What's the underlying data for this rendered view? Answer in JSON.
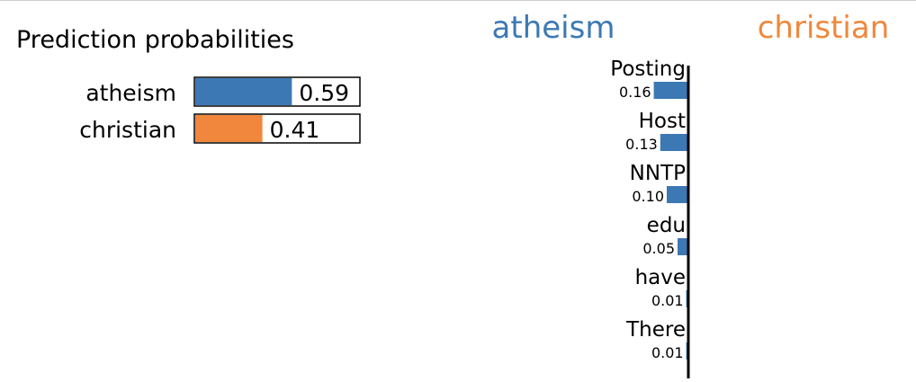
{
  "colors": {
    "atheism": "#3c78b4",
    "christian": "#f0873c"
  },
  "chart_data": [
    {
      "type": "bar",
      "title": "Prediction probabilities",
      "categories": [
        "atheism",
        "christian"
      ],
      "values": [
        0.59,
        0.41
      ],
      "value_labels": [
        "0.59",
        "0.41"
      ],
      "xlim": [
        0,
        1
      ]
    },
    {
      "type": "bar",
      "class_labels": {
        "left": "atheism",
        "right": "christian"
      },
      "features": [
        "Posting",
        "Host",
        "NNTP",
        "edu",
        "have",
        "There"
      ],
      "values": [
        0.16,
        0.13,
        0.1,
        0.05,
        0.01,
        0.01
      ],
      "value_labels": [
        "0.16",
        "0.13",
        "0.10",
        "0.05",
        "0.01",
        "0.01"
      ],
      "side": [
        "atheism",
        "atheism",
        "atheism",
        "atheism",
        "atheism",
        "atheism"
      ]
    }
  ]
}
